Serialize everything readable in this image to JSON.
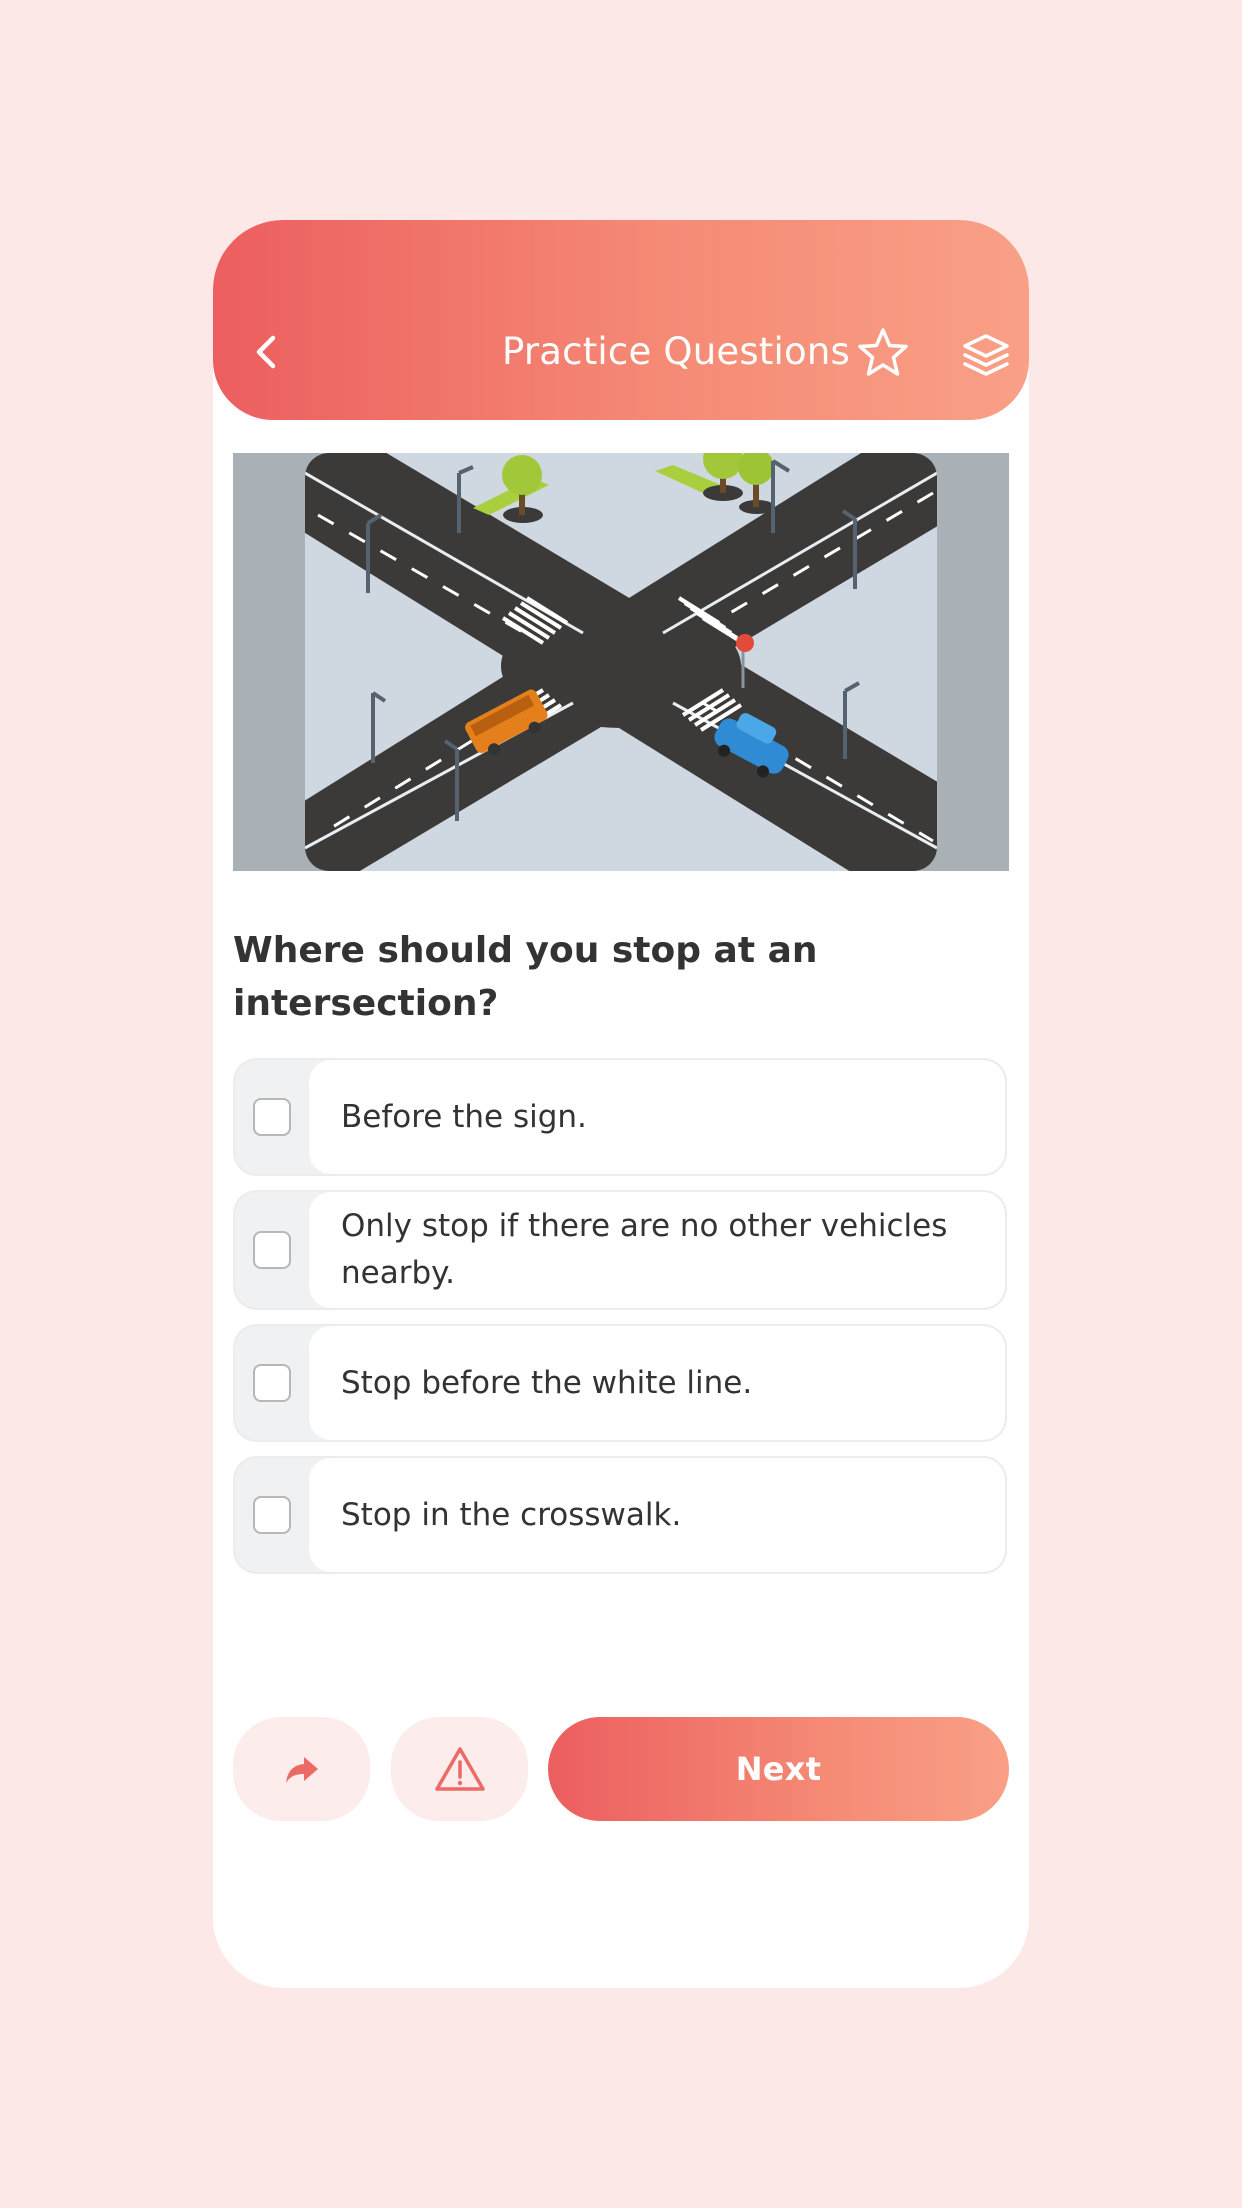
{
  "header": {
    "title": "Practice Questions",
    "back_icon": "chevron-left-icon",
    "favorite_icon": "star-icon",
    "layers_icon": "layers-icon"
  },
  "illustration": {
    "subject": "intersection-illustration"
  },
  "question": {
    "text": "Where should you stop at an intersection?"
  },
  "options": [
    {
      "label": "Before the sign."
    },
    {
      "label": "Only stop if there are no other vehicles nearby."
    },
    {
      "label": "Stop before the white line."
    },
    {
      "label": "Stop in the crosswalk."
    }
  ],
  "footer": {
    "share_icon": "share-icon",
    "report_icon": "warning-icon",
    "next_label": "Next"
  },
  "colors": {
    "background": "#fde8e8",
    "accent_start": "#ec5e5f",
    "accent_end": "#f9a086",
    "text": "#333333"
  }
}
